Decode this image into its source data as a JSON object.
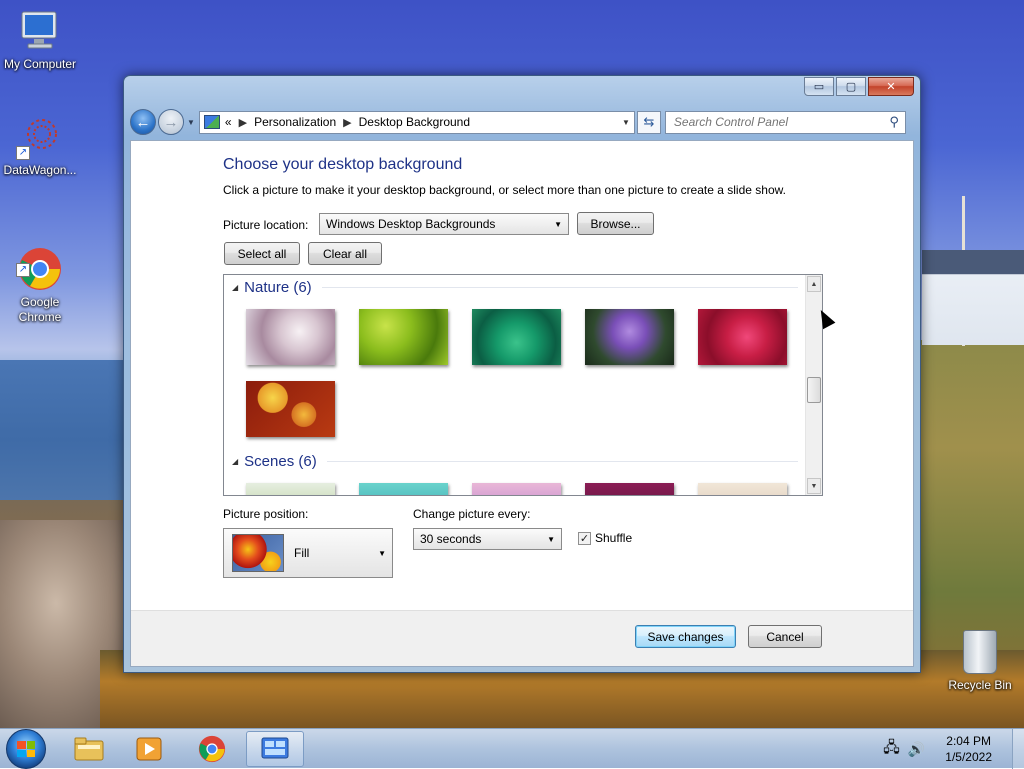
{
  "desktop": {
    "icons": [
      {
        "label": "My Computer"
      },
      {
        "label": "DataWagon..."
      },
      {
        "label": "Google\nChrome"
      }
    ],
    "recycle_bin": {
      "label": "Recycle Bin"
    }
  },
  "window": {
    "caption": {
      "minimize": "▭",
      "maximize": "▢",
      "close": "✕"
    },
    "breadcrumb": {
      "prefix": "«",
      "items": [
        "Personalization",
        "Desktop Background"
      ],
      "separator": "▶"
    },
    "search": {
      "placeholder": "Search Control Panel"
    },
    "heading": "Choose your desktop background",
    "description": "Click a picture to make it your desktop background, or select more than one picture to create a slide show.",
    "picture_location": {
      "label": "Picture location:",
      "value": "Windows Desktop Backgrounds"
    },
    "browse_label": "Browse...",
    "select_all_label": "Select all",
    "clear_all_label": "Clear all",
    "groups": [
      {
        "title": "Nature (6)"
      },
      {
        "title": "Scenes (6)"
      }
    ],
    "picture_position": {
      "label": "Picture position:",
      "value": "Fill"
    },
    "change_picture": {
      "label": "Change picture every:",
      "value": "30 seconds"
    },
    "shuffle": {
      "label": "Shuffle",
      "checked": true,
      "mark": "✓"
    },
    "save_label": "Save changes",
    "cancel_label": "Cancel"
  },
  "taskbar": {
    "clock_time": "2:04 PM",
    "clock_date": "1/5/2022",
    "apps": [
      "start-menu",
      "file-explorer",
      "media-player",
      "google-chrome",
      "control-panel"
    ]
  },
  "colors": {
    "heading": "#1e3287",
    "default_button_border": "#3c7fb1"
  }
}
